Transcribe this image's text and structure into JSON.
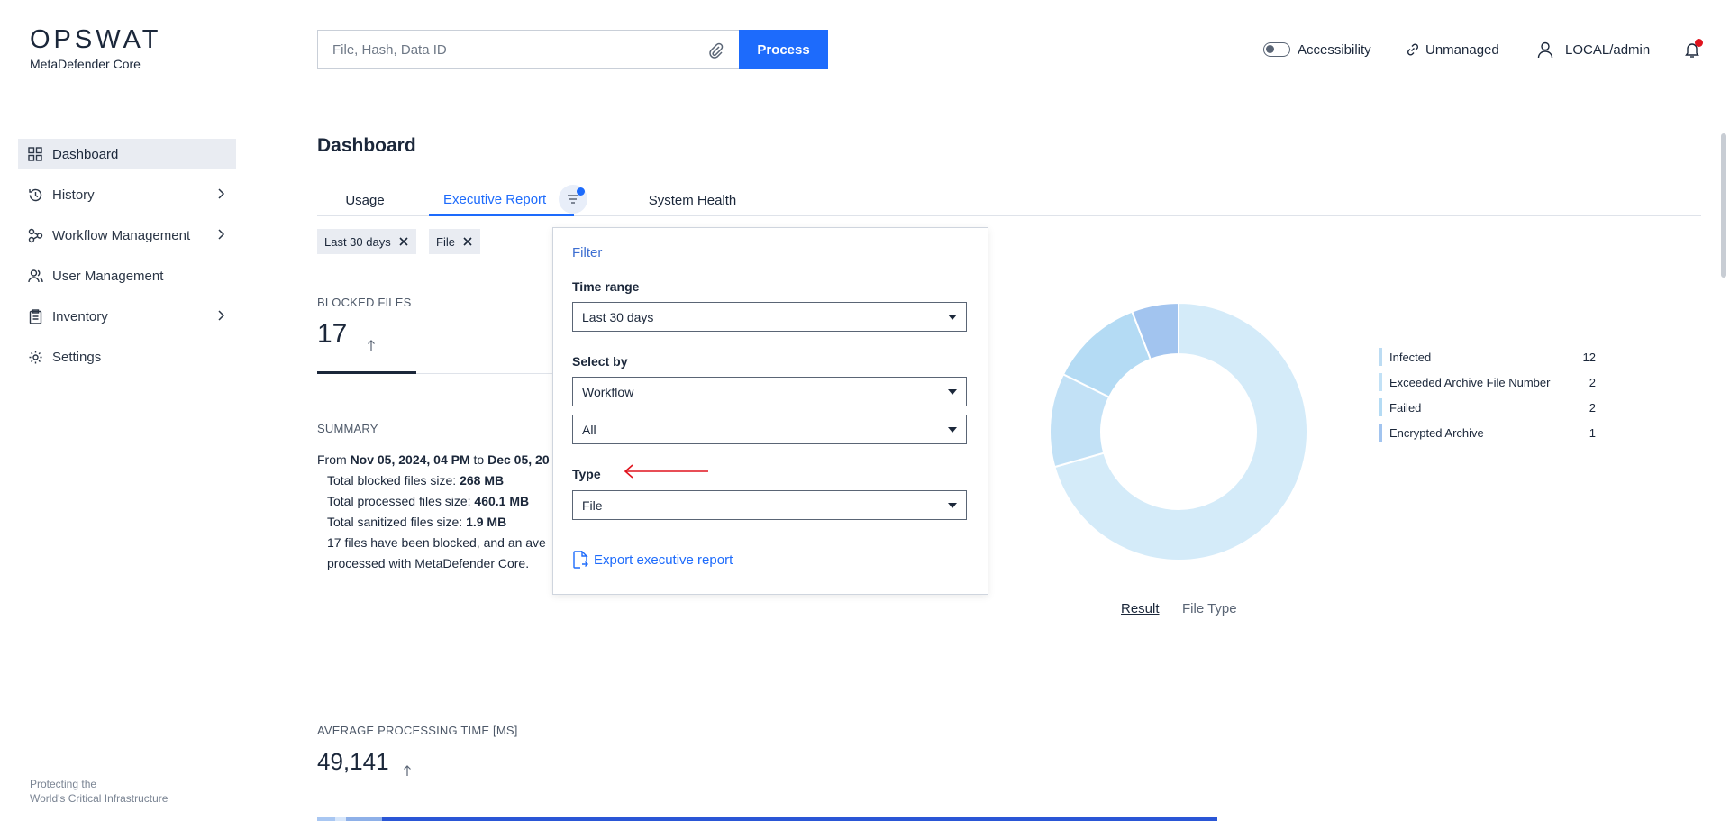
{
  "brand": {
    "logo_text": "OPSWAT",
    "product": "MetaDefender Core"
  },
  "sidebar": {
    "items": [
      {
        "label": "Dashboard",
        "icon": "grid-icon",
        "active": true
      },
      {
        "label": "History",
        "icon": "history-icon"
      },
      {
        "label": "Workflow Management",
        "icon": "workflow-icon"
      },
      {
        "label": "User Management",
        "icon": "users-icon"
      },
      {
        "label": "Inventory",
        "icon": "clipboard-icon"
      },
      {
        "label": "Settings",
        "icon": "gear-icon"
      }
    ],
    "tagline_line1": "Protecting the",
    "tagline_line2": "World's Critical Infrastructure"
  },
  "topbar": {
    "search_placeholder": "File, Hash, Data ID",
    "process_label": "Process",
    "accessibility_label": "Accessibility",
    "unmanaged_label": "Unmanaged",
    "user_label": "LOCAL/admin"
  },
  "main": {
    "title": "Dashboard",
    "tabs": [
      {
        "label": "Usage"
      },
      {
        "label": "Executive Report",
        "active": true
      },
      {
        "label": "System Health"
      }
    ],
    "chips": [
      {
        "label": "Last 30 days"
      },
      {
        "label": "File"
      }
    ],
    "blocked_files": {
      "label": "BLOCKED FILES",
      "value": "17"
    },
    "summary": {
      "label": "SUMMARY",
      "from_prefix": "From ",
      "from_date": "Nov 05, 2024, 04 PM",
      "to_word": " to ",
      "to_date": "Dec 05, 20",
      "blocked_size_label": "Total blocked files size: ",
      "blocked_size_value": "268 MB",
      "processed_size_label": "Total processed files size: ",
      "processed_size_value": "460.1 MB",
      "sanitized_size_label": "Total sanitized files size: ",
      "sanitized_size_value": "1.9 MB",
      "line4": "17 files have been blocked, and an ave",
      "line5": "processed with MetaDefender Core."
    },
    "avg_processing": {
      "label": "AVERAGE PROCESSING TIME [MS]",
      "value": "49,141"
    }
  },
  "filter_popup": {
    "title": "Filter",
    "time_range_label": "Time range",
    "time_range_value": "Last 30 days",
    "select_by_label": "Select by",
    "select_by_value": "Workflow",
    "select_by_sub_value": "All",
    "type_label": "Type",
    "type_value": "File",
    "export_label": "Export executive report"
  },
  "chart_data": {
    "type": "pie",
    "categories": [
      "Infected",
      "Exceeded Archive File Number",
      "Failed",
      "Encrypted Archive"
    ],
    "values": [
      12,
      2,
      2,
      1
    ],
    "colors": [
      "#d4ebf9",
      "#c2e1f6",
      "#b4dbf4",
      "#a2c4ef"
    ],
    "legend_placement": "right",
    "views": [
      "Result",
      "File Type"
    ],
    "active_view": "Result"
  },
  "colors": {
    "accent": "#1d6bfc",
    "annotation_arrow": "#e0141e"
  }
}
